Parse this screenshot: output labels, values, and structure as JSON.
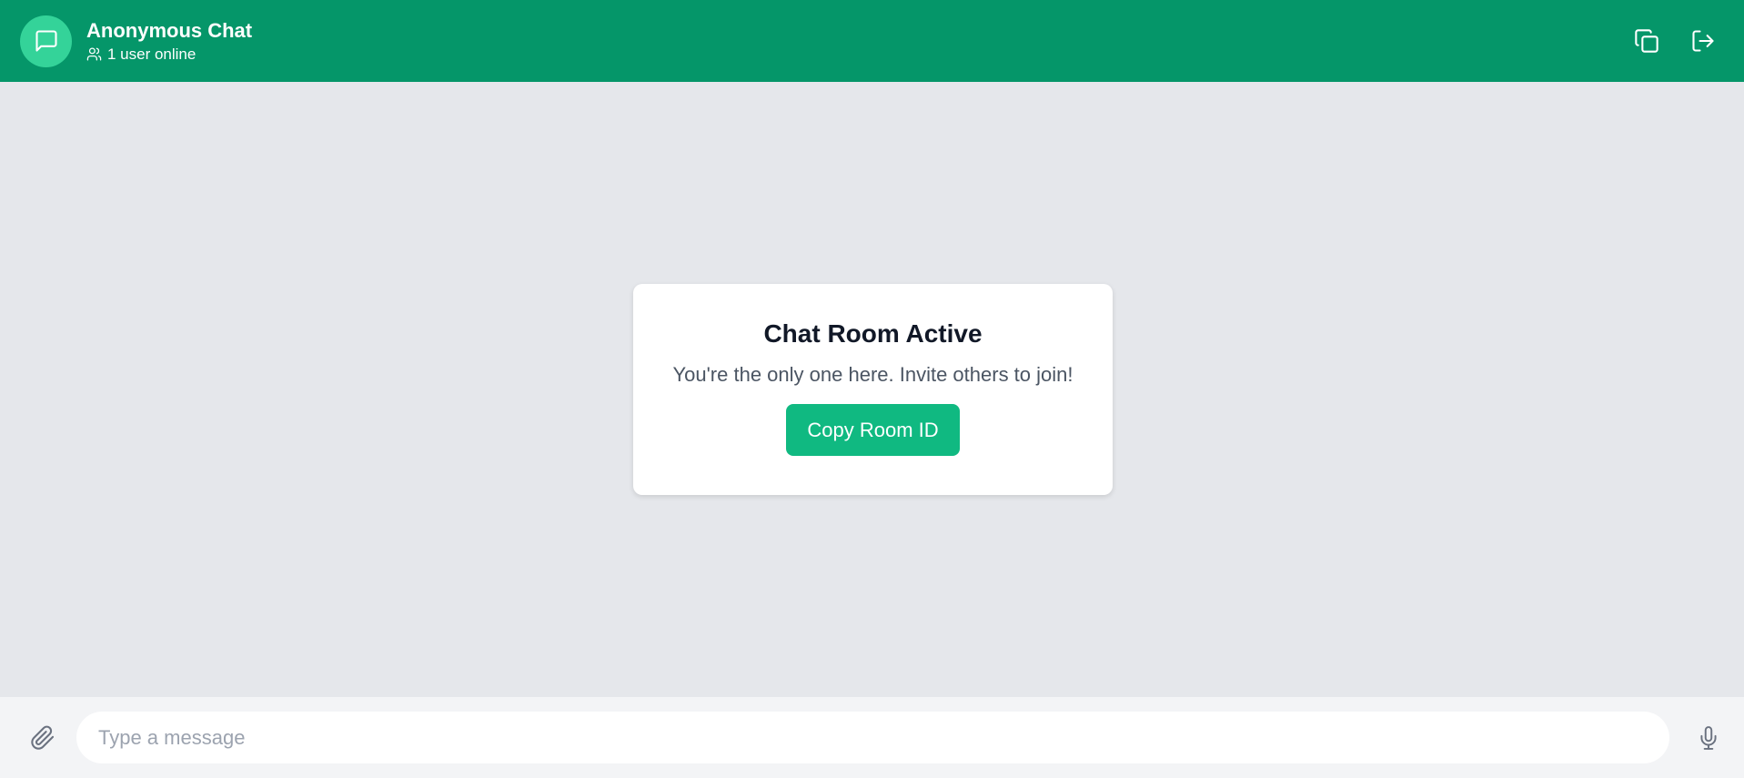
{
  "header": {
    "title": "Anonymous Chat",
    "online_status": "1 user online",
    "avatar_icon": "message-square-icon",
    "actions": [
      {
        "icon": "copy-icon"
      },
      {
        "icon": "log-out-icon"
      }
    ]
  },
  "empty_state": {
    "title": "Chat Room Active",
    "message": "You're the only one here. Invite others to join!",
    "button_label": "Copy Room ID"
  },
  "composer": {
    "placeholder": "Type a message",
    "value": "",
    "attach_icon": "paperclip-icon",
    "mic_icon": "mic-icon"
  },
  "colors": {
    "header_bg": "#059669",
    "avatar_bg": "#34d399",
    "button_bg": "#10b981",
    "main_bg": "#e5e7eb",
    "footer_bg": "#f3f4f6"
  }
}
